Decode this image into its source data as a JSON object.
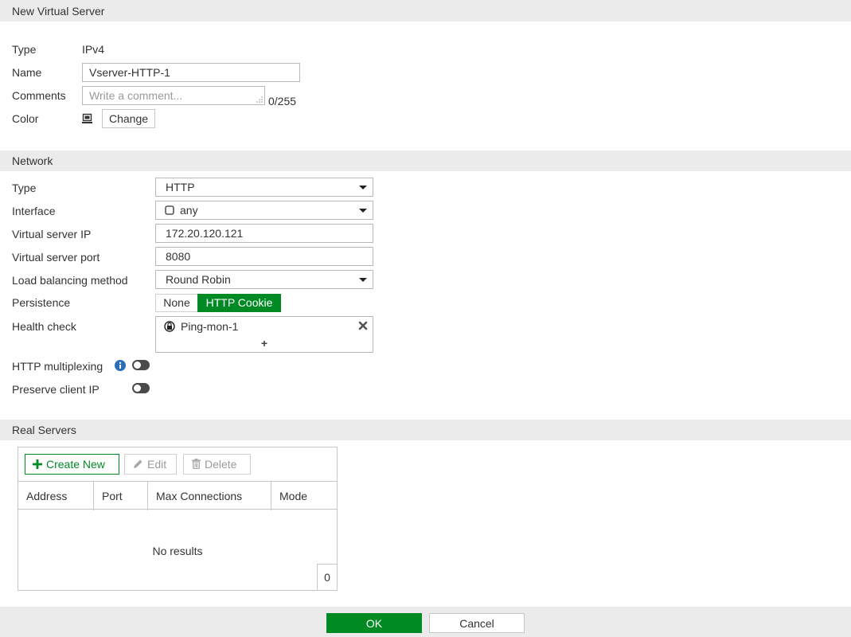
{
  "dialog": {
    "title": "New Virtual Server"
  },
  "general": {
    "type_label": "Type",
    "type_value": "IPv4",
    "name_label": "Name",
    "name_value": "Vserver-HTTP-1",
    "comments_label": "Comments",
    "comments_placeholder": "Write a comment...",
    "comments_counter": "0/255",
    "color_label": "Color",
    "change_button": "Change"
  },
  "network": {
    "header": "Network",
    "type_label": "Type",
    "type_value": "HTTP",
    "interface_label": "Interface",
    "interface_value": "any",
    "vip_label": "Virtual server IP",
    "vip_value": "172.20.120.121",
    "vport_label": "Virtual server port",
    "vport_value": "8080",
    "lb_label": "Load balancing method",
    "lb_value": "Round Robin",
    "persistence_label": "Persistence",
    "persistence_options": [
      "None",
      "HTTP Cookie"
    ],
    "persistence_selected": "HTTP Cookie",
    "health_label": "Health check",
    "health_item": "Ping-mon-1",
    "health_add": "+",
    "multiplexing_label": "HTTP multiplexing",
    "multiplexing_on": false,
    "preserve_label": "Preserve client IP",
    "preserve_on": false
  },
  "real_servers": {
    "header": "Real Servers",
    "create_new": "Create New",
    "edit": "Edit",
    "delete": "Delete",
    "columns": [
      "Address",
      "Port",
      "Max Connections",
      "Mode"
    ],
    "empty_text": "No results",
    "count": "0"
  },
  "footer": {
    "ok": "OK",
    "cancel": "Cancel"
  },
  "colors": {
    "accent": "#008a24",
    "header_bg": "#ebebeb",
    "border": "#b8b8b8"
  }
}
